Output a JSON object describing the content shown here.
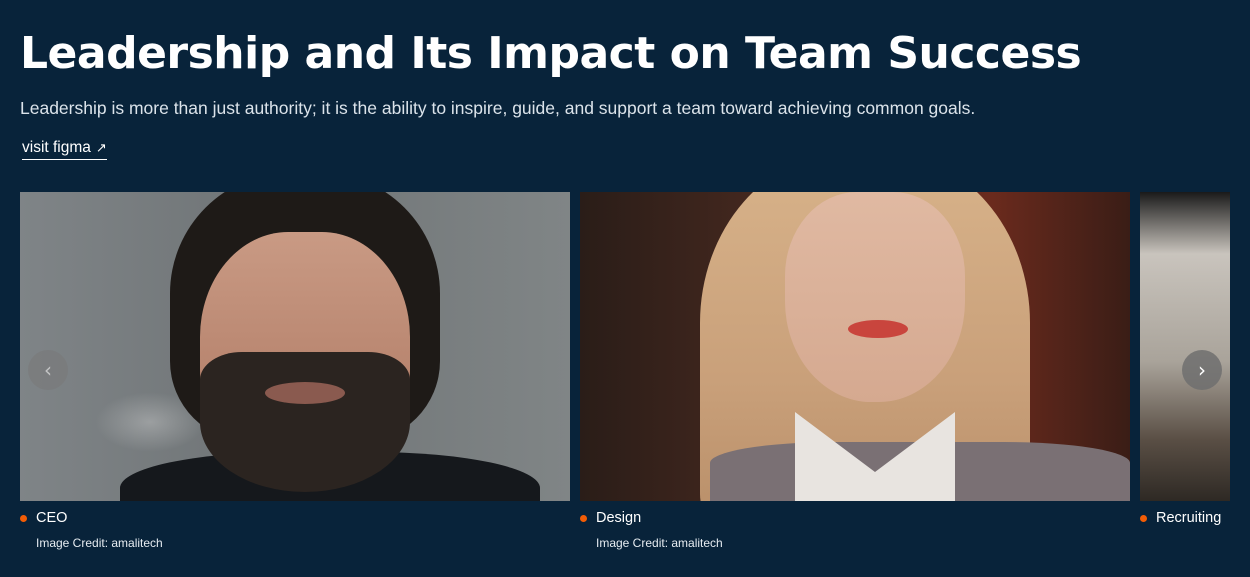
{
  "header": {
    "title": "Leadership and Its Impact on Team Success",
    "subtitle": "Leadership is more than just authority; it is the ability to inspire, guide, and support a team toward achieving common goals.",
    "link_label": "visit figma",
    "link_icon": "↗"
  },
  "carousel": {
    "prev_icon": "‹",
    "next_icon": "›",
    "slides": [
      {
        "caption": "CEO",
        "credit": "Image Credit: amalitech"
      },
      {
        "caption": "Design",
        "credit": "Image Credit: amalitech"
      },
      {
        "caption": "Recruiting"
      }
    ]
  },
  "colors": {
    "background": "#08233a",
    "accent_dot": "#f25c05",
    "text": "#ffffff"
  }
}
